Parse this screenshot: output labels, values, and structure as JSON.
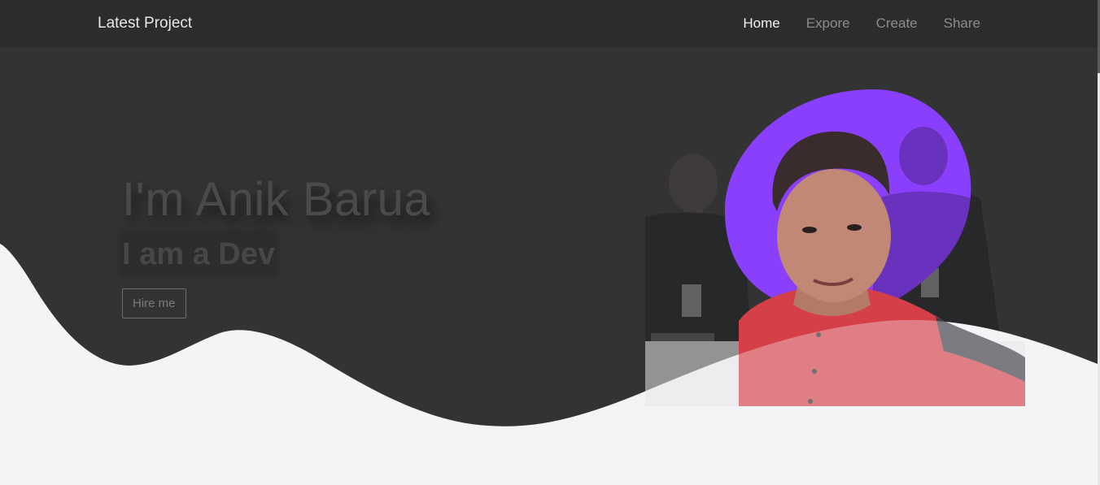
{
  "navbar": {
    "brand": "Latest Project",
    "items": [
      {
        "label": "Home",
        "active": true
      },
      {
        "label": "Expore",
        "active": false
      },
      {
        "label": "Create",
        "active": false
      },
      {
        "label": "Share",
        "active": false
      }
    ]
  },
  "hero": {
    "title": "I'm Anik Barua",
    "subtitle": "I am a Dev",
    "cta_label": "Hire me"
  },
  "colors": {
    "navbar_bg": "#2b2c2e",
    "hero_bg": "#333333",
    "page_bg": "#f3f4f6",
    "blob_accent": "#8a3ffc"
  },
  "images": {
    "background_photo": "group-photo",
    "profile_photo": "selfie-portrait"
  }
}
